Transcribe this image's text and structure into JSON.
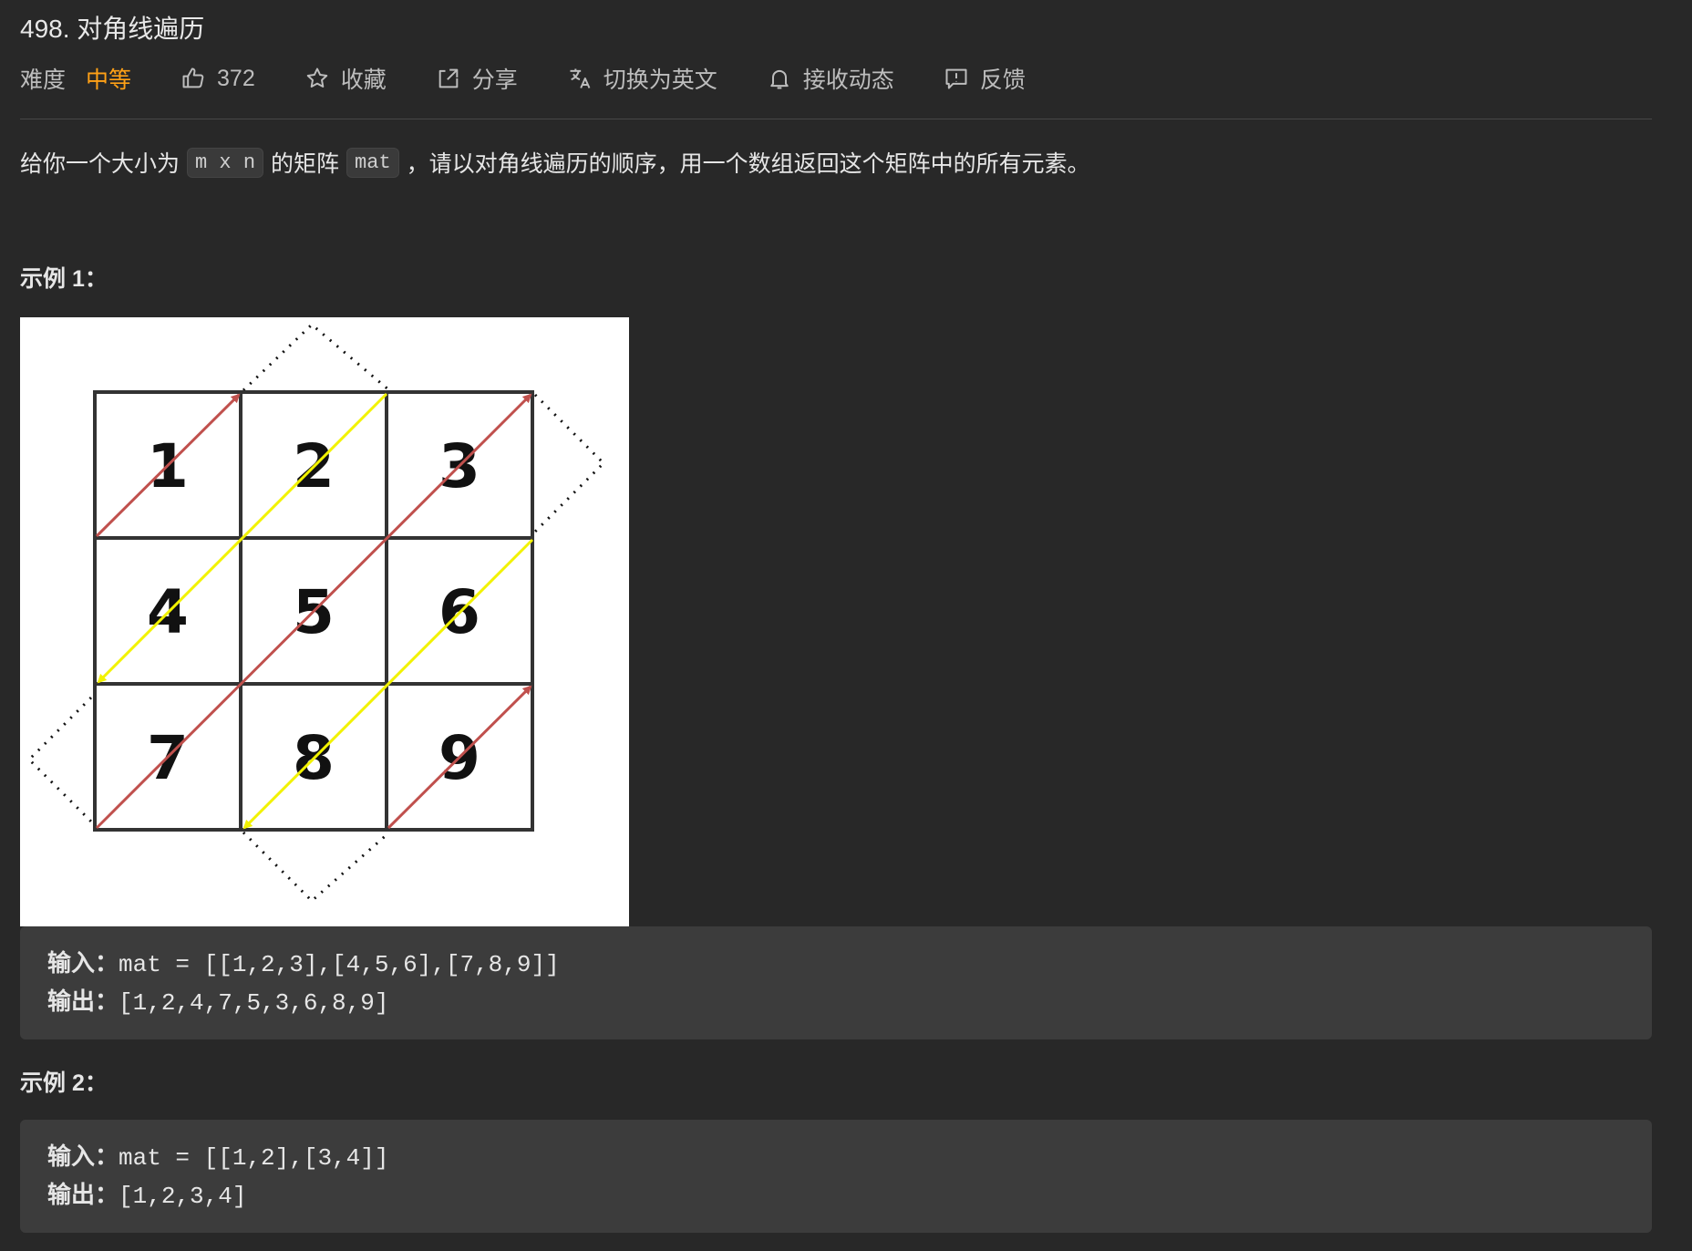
{
  "problem": {
    "title": "498. 对角线遍历"
  },
  "meta": {
    "difficulty_label": "难度",
    "difficulty_value": "中等",
    "likes": "372",
    "favorite": "收藏",
    "share": "分享",
    "switch_lang": "切换为英文",
    "subscribe": "接收动态",
    "feedback": "反馈",
    "accent_color": "#ffa116"
  },
  "description": {
    "part1": "给你一个大小为",
    "code1": "m x n",
    "part2": "的矩阵",
    "code2": "mat",
    "part3": "，请以对角线遍历的顺序，用一个数组返回这个矩阵中的所有元素。"
  },
  "example1": {
    "heading": "示例 1：",
    "grid": [
      "1",
      "2",
      "3",
      "4",
      "5",
      "6",
      "7",
      "8",
      "9"
    ],
    "input_label": "输入：",
    "input_value": "mat = [[1,2,3],[4,5,6],[7,8,9]]",
    "output_label": "输出：",
    "output_value": "[1,2,4,7,5,3,6,8,9]"
  },
  "example2": {
    "heading": "示例 2：",
    "input_label": "输入：",
    "input_value": "mat = [[1,2],[3,4]]",
    "output_label": "输出：",
    "output_value": "[1,2,3,4]"
  }
}
